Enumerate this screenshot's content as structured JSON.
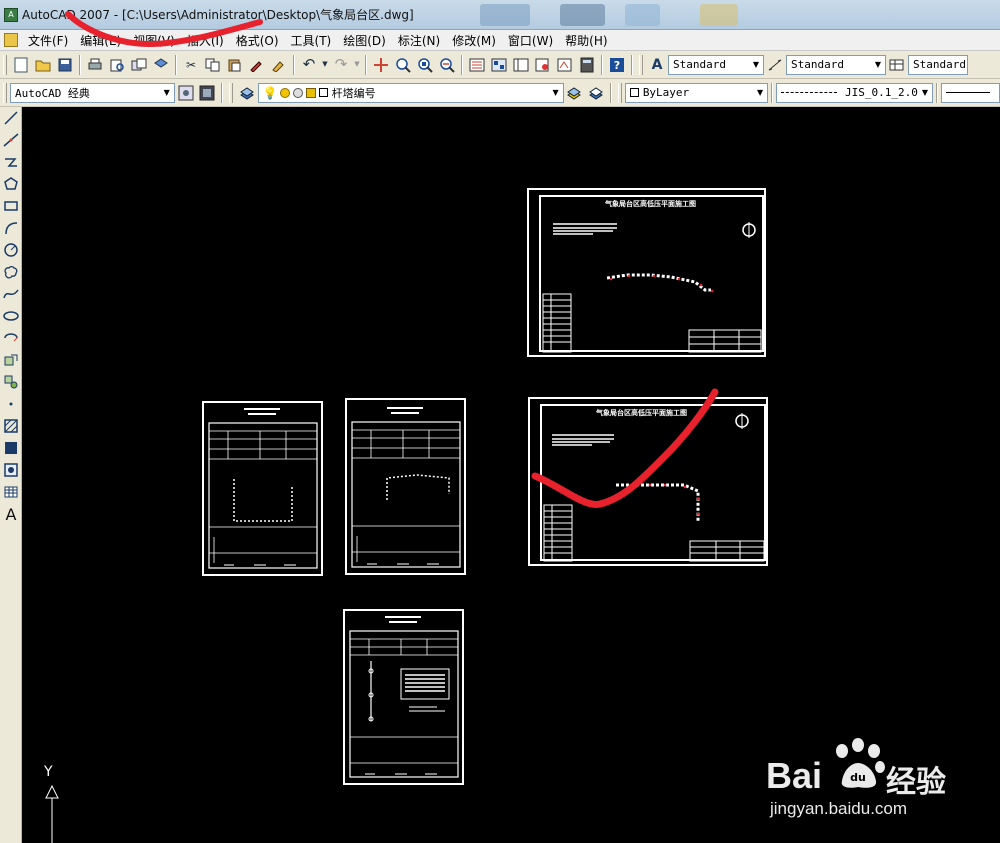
{
  "window": {
    "title": "AutoCAD 2007 - [C:\\Users\\Administrator\\Desktop\\气象局台区.dwg]"
  },
  "menu": {
    "items": [
      {
        "label": "文件(F)"
      },
      {
        "label": "编辑(E)"
      },
      {
        "label": "视图(V)"
      },
      {
        "label": "插入(I)"
      },
      {
        "label": "格式(O)"
      },
      {
        "label": "工具(T)"
      },
      {
        "label": "绘图(D)"
      },
      {
        "label": "标注(N)"
      },
      {
        "label": "修改(M)"
      },
      {
        "label": "窗口(W)"
      },
      {
        "label": "帮助(H)"
      }
    ]
  },
  "toolbar1": {
    "text_style": "Standard",
    "dim_style": "Standard",
    "table_style": "Standard"
  },
  "toolbar2": {
    "workspace": "AutoCAD 经典",
    "layer": "杆塔编号",
    "color": "ByLayer",
    "linetype": "JIS_0.1_2.0"
  },
  "canvas": {
    "sheet_title_1": "气象局台区高低压平面施工图",
    "sheet_title_2": "气象局台区高低压平面施工图",
    "ucs_y": "Y"
  },
  "watermark": {
    "brand": "Bai",
    "brand_cn": "经验",
    "url": "jingyan.baidu.com"
  },
  "colors": {
    "background": "#000000",
    "annotation": "#e8222c",
    "titlebar": "#c9dbe9",
    "toolbar": "#ece9d8"
  },
  "icons": {
    "left_toolbar": [
      "line-icon",
      "construction-line-icon",
      "polyline-icon",
      "polygon-icon",
      "rectangle-icon",
      "arc-icon",
      "circle-icon",
      "revision-cloud-icon",
      "spline-icon",
      "ellipse-icon",
      "ellipse-arc-icon",
      "insert-block-icon",
      "make-block-icon",
      "point-icon",
      "hatch-icon",
      "gradient-icon",
      "region-icon",
      "table-icon",
      "multiline-text-icon"
    ]
  }
}
